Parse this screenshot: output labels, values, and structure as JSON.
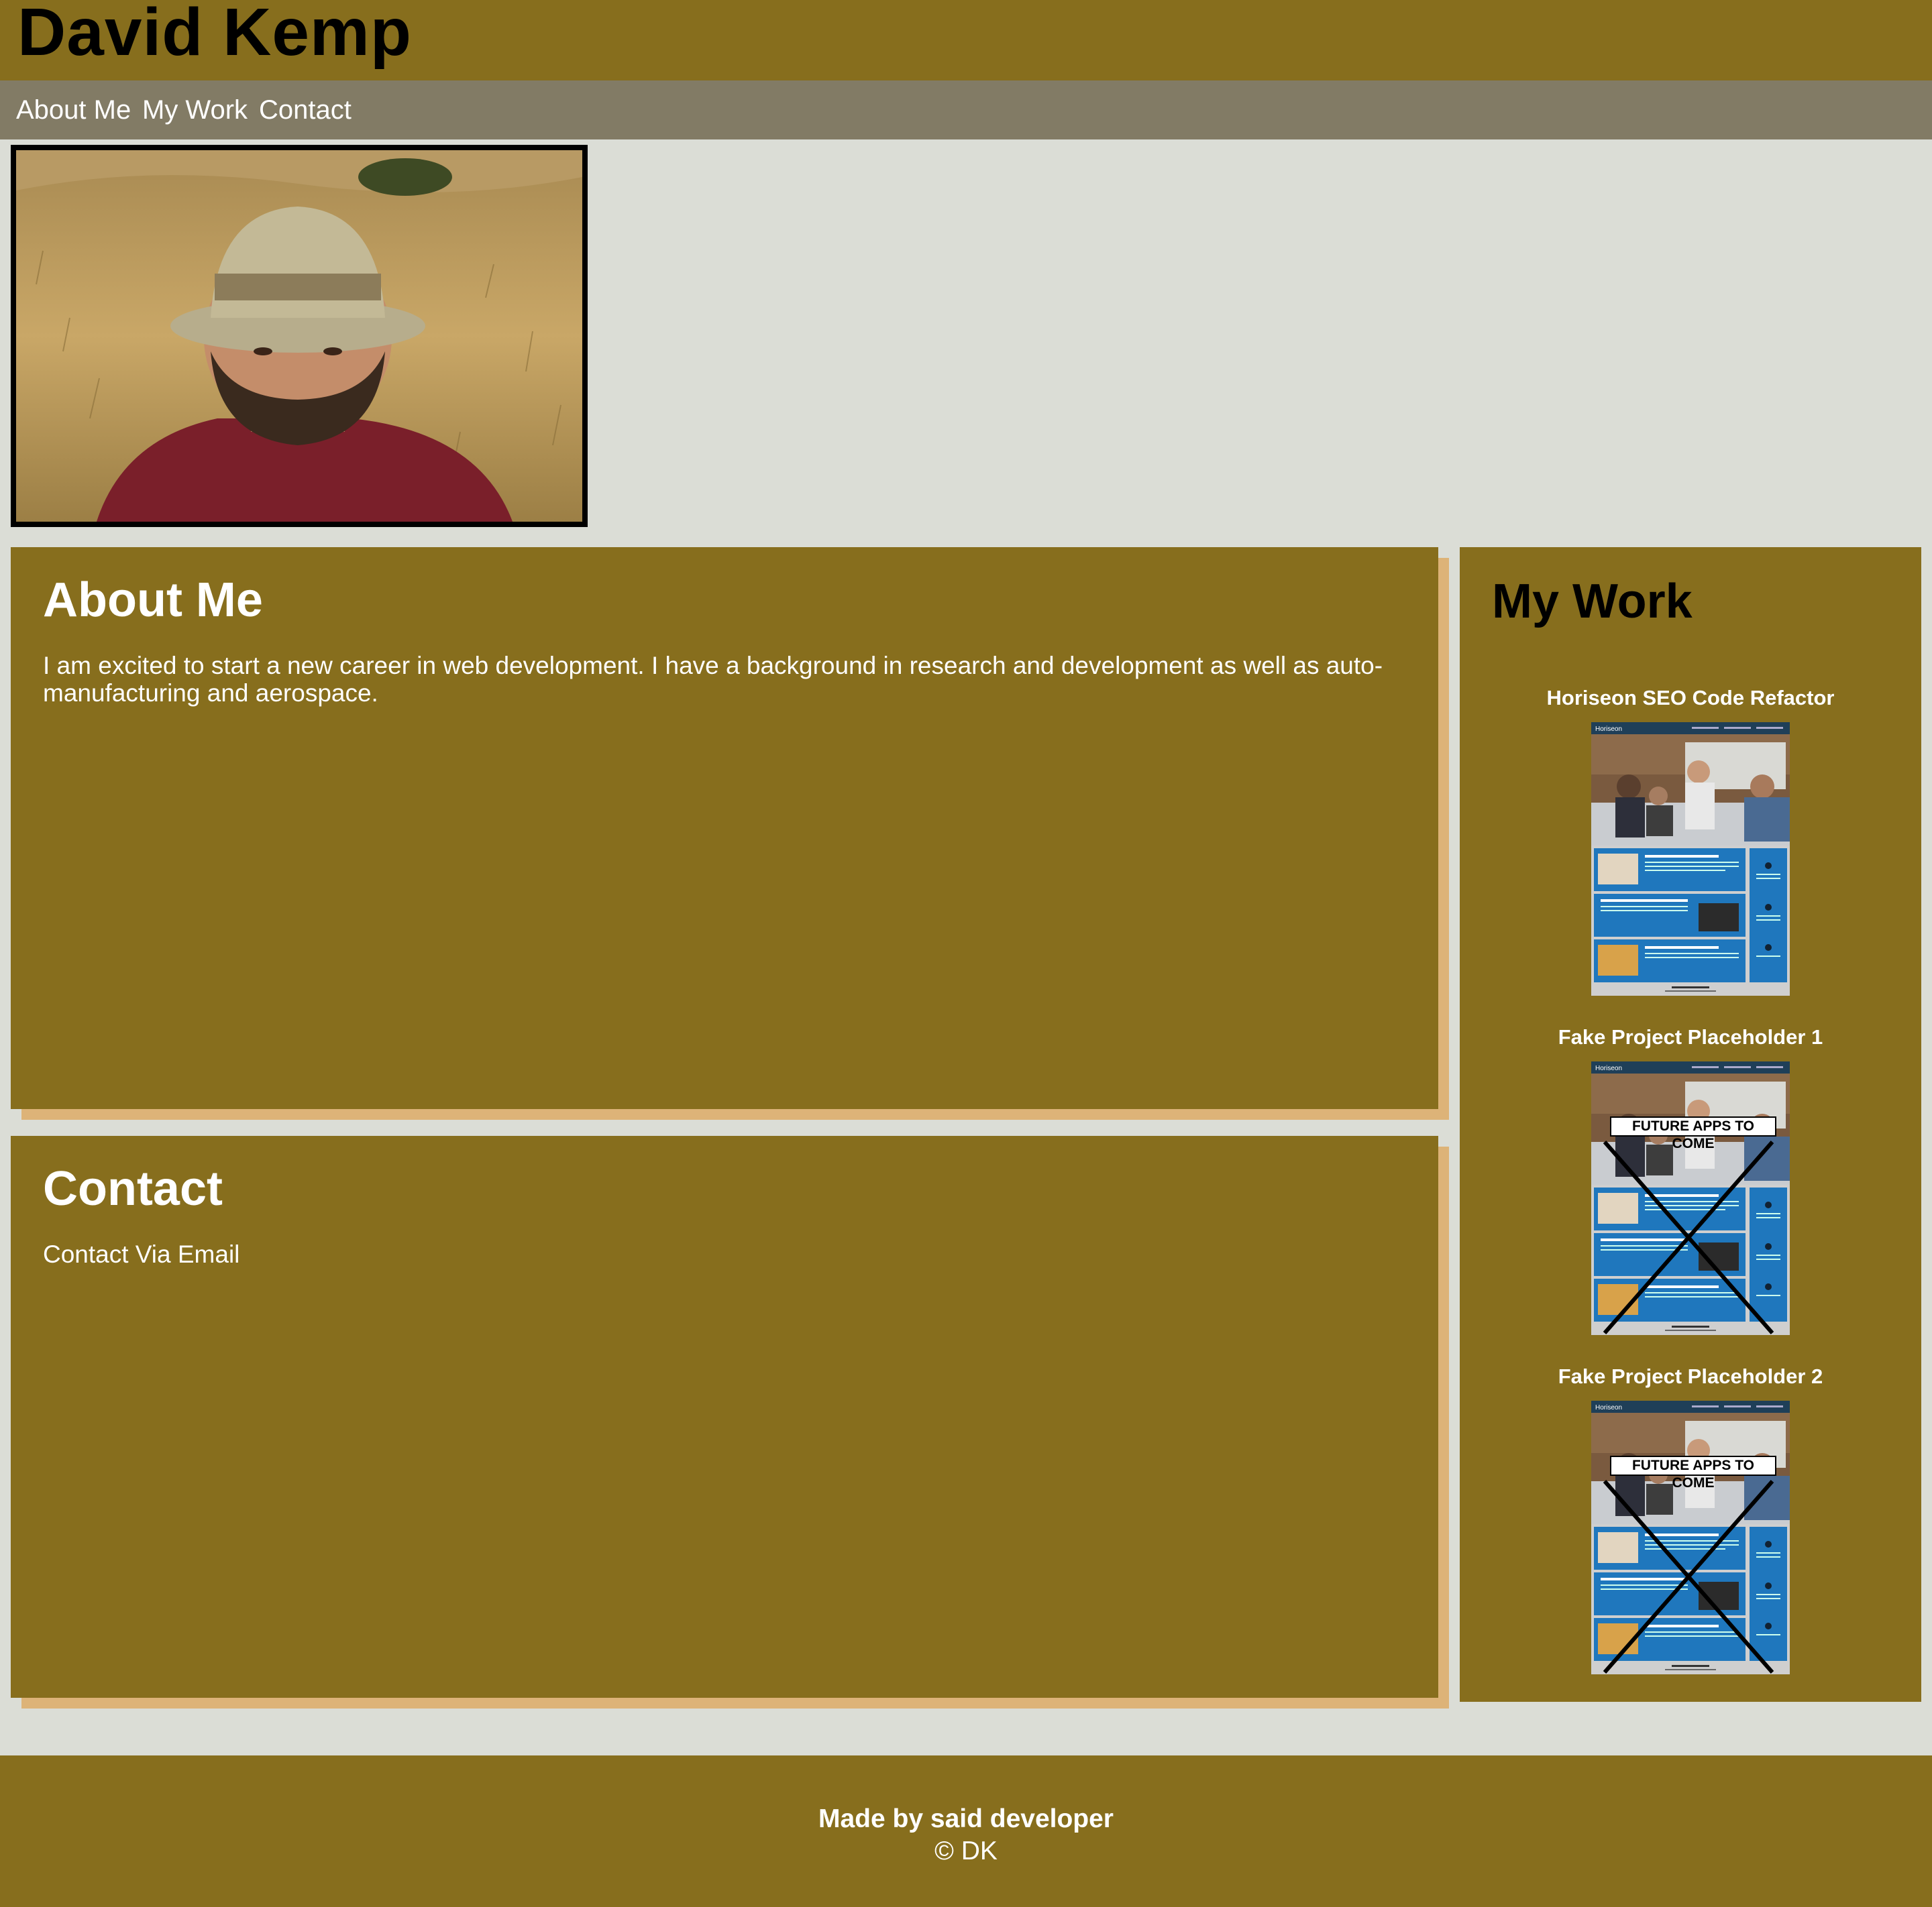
{
  "header": {
    "title": "David Kemp"
  },
  "nav": {
    "about": "About Me",
    "work": "My Work",
    "contact": "Contact"
  },
  "about": {
    "heading": "About Me",
    "text": "I am excited to start a new career in web development. I have a background in research and development as well as auto-manufacturing and aerospace."
  },
  "contact": {
    "heading": "Contact",
    "link": "Contact Via Email"
  },
  "work": {
    "heading": "My Work",
    "projects": [
      {
        "title": "Horiseon SEO Code Refactor"
      },
      {
        "title": "Fake Project Placeholder 1",
        "overlay": "FUTURE APPS TO COME"
      },
      {
        "title": "Fake Project Placeholder 2",
        "overlay": "FUTURE APPS TO COME"
      }
    ]
  },
  "footer": {
    "credit": "Made by said developer",
    "copyright": "© DK"
  },
  "colors": {
    "background": "#DBDDD6",
    "primary": "#876E1D",
    "nav": "#827B65",
    "shadow": "#DDB378"
  }
}
